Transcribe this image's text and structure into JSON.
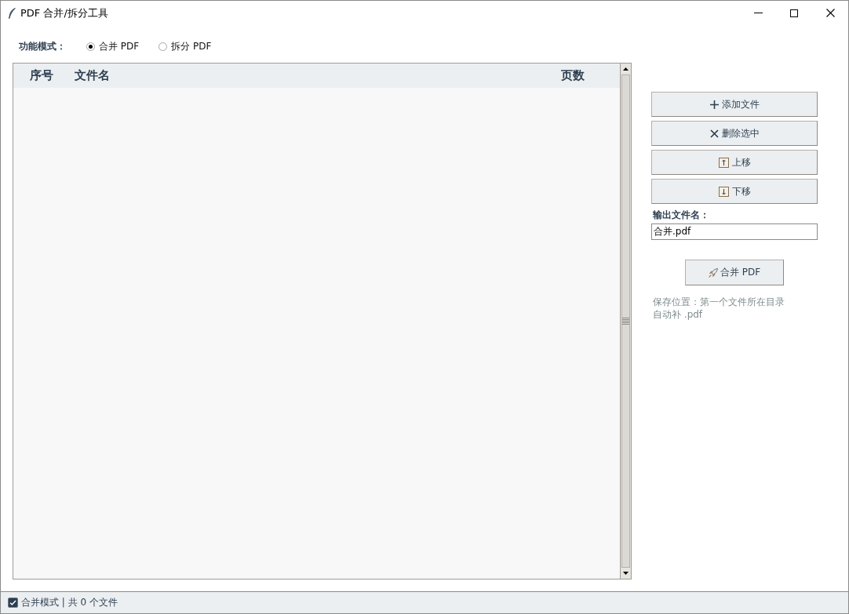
{
  "window": {
    "title": "PDF 合并/拆分工具"
  },
  "mode": {
    "label": "功能模式：",
    "options": [
      {
        "label": "合并 PDF",
        "selected": true
      },
      {
        "label": "拆分 PDF",
        "selected": false
      }
    ]
  },
  "table": {
    "columns": [
      "序号",
      "文件名",
      "页数"
    ]
  },
  "actions": [
    {
      "kind": "add",
      "label": "添加文件"
    },
    {
      "kind": "delete",
      "label": "删除选中"
    },
    {
      "kind": "up",
      "label": "上移"
    },
    {
      "kind": "down",
      "label": "下移"
    }
  ],
  "output": {
    "label": "输出文件名：",
    "value": "合并.pdf"
  },
  "run_button": {
    "label": "合并 PDF"
  },
  "notes": [
    "保存位置：第一个文件所在目录",
    "自动补 .pdf"
  ],
  "status_bar": {
    "text": "合并模式 | 共 0 个文件"
  }
}
